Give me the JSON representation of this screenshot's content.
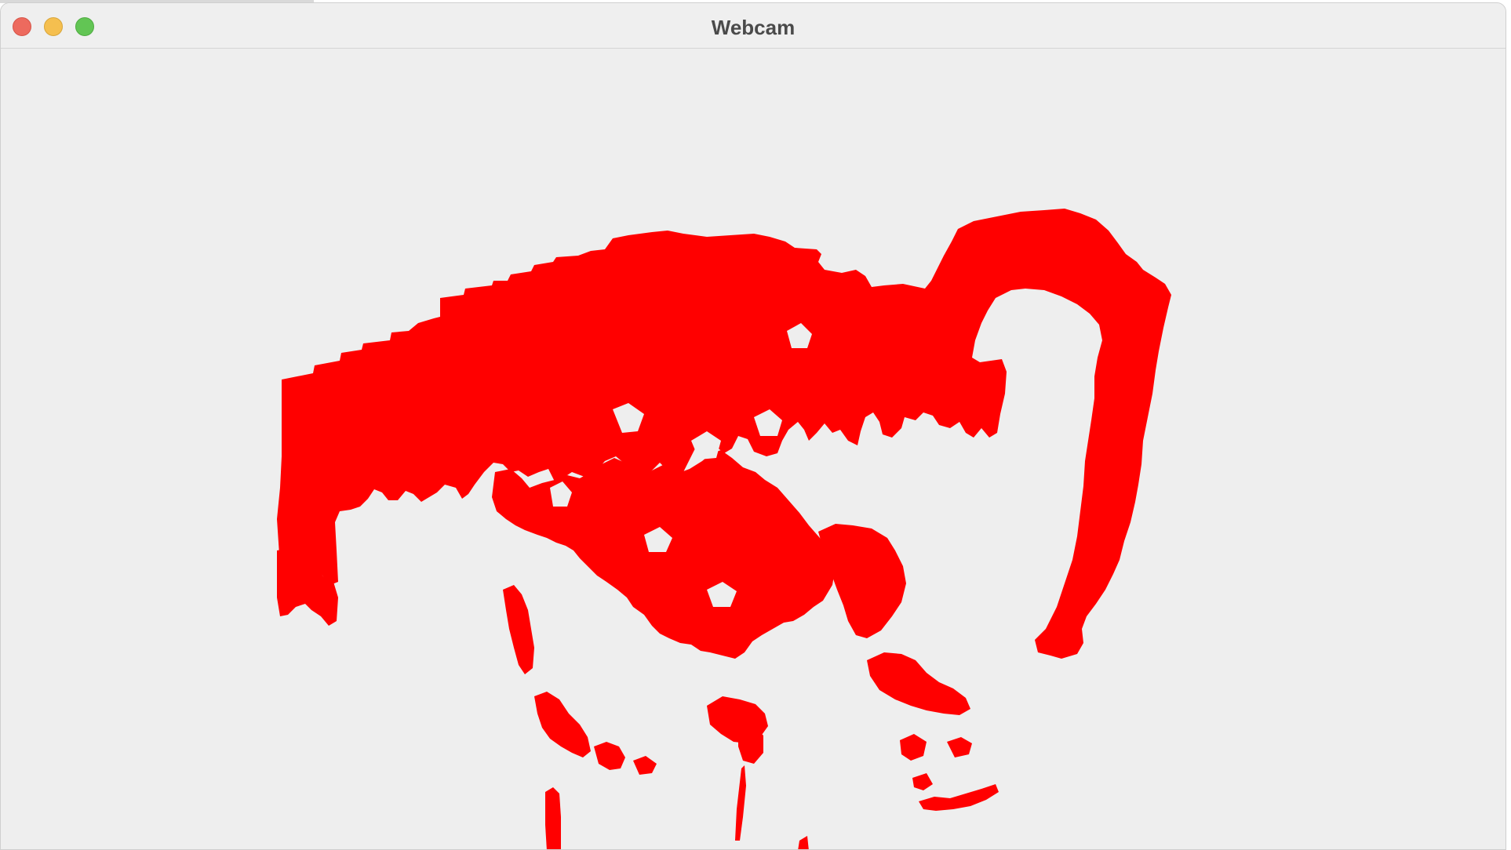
{
  "window": {
    "title": "Webcam",
    "controls": {
      "close": "close-icon",
      "minimize": "minimize-icon",
      "zoom": "zoom-icon"
    }
  },
  "feed": {
    "mask_color": "#ff0000",
    "background_color": "#eeeeee"
  }
}
